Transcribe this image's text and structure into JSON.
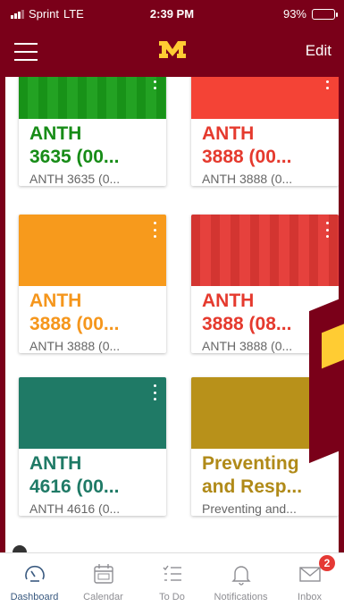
{
  "status": {
    "carrier": "Sprint",
    "network": "LTE",
    "time": "2:39 PM",
    "battery": "93%",
    "battery_level": 0.93
  },
  "nav": {
    "edit_label": "Edit",
    "logo": "university-m-logo",
    "menu_icon": "hamburger-icon"
  },
  "cards": [
    {
      "title": "ANTH\n3635 (00...",
      "subtitle": "ANTH 3635 (0...",
      "color": "#1a9e1a",
      "title_color": "#178c17",
      "has_image": true
    },
    {
      "title": "ANTH\n3888 (00...",
      "subtitle": "ANTH 3888 (0...",
      "color": "#f44336",
      "title_color": "#e53a2e",
      "has_image": false
    },
    {
      "title": "ANTH\n3888 (00...",
      "subtitle": "ANTH 3888 (0...",
      "color": "#f79a1c",
      "title_color": "#f5961c",
      "has_image": false
    },
    {
      "title": "ANTH\n3888 (08...",
      "subtitle": "ANTH 3888 (0...",
      "color": "#e53935",
      "title_color": "#e53a2e",
      "has_image": true
    },
    {
      "title": "ANTH\n4616 (00...",
      "subtitle": "ANTH 4616 (0...",
      "color": "#1f7a66",
      "title_color": "#1f7a66",
      "has_image": false
    },
    {
      "title": "Preventing\nand Resp...",
      "subtitle": "Preventing and...",
      "color": "#b8911a",
      "title_color": "#b08a18",
      "has_image": false
    }
  ],
  "tabs": [
    {
      "label": "Dashboard",
      "icon": "dashboard-icon",
      "active": true
    },
    {
      "label": "Calendar",
      "icon": "calendar-icon",
      "active": false
    },
    {
      "label": "To Do",
      "icon": "todo-icon",
      "active": false
    },
    {
      "label": "Notifications",
      "icon": "bell-icon",
      "active": false
    },
    {
      "label": "Inbox",
      "icon": "envelope-icon",
      "active": false,
      "badge": "2"
    }
  ]
}
